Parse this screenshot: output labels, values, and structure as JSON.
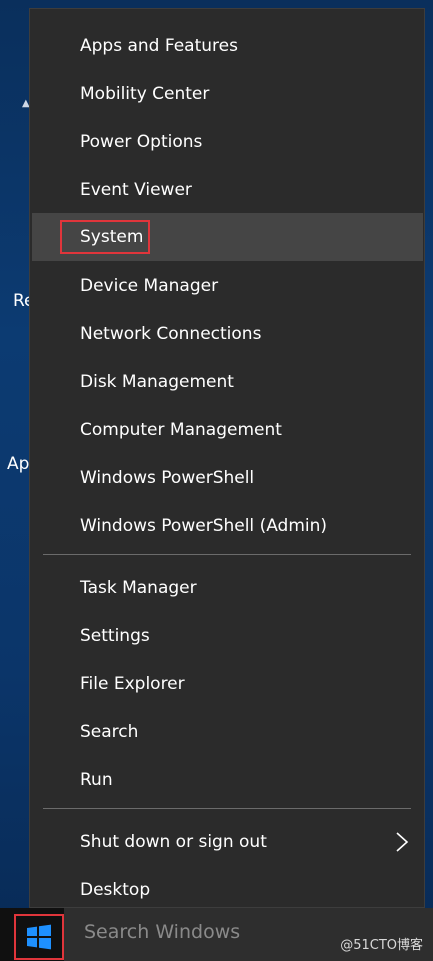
{
  "desktop": {
    "partial_labels": [
      "Re",
      "Ap"
    ]
  },
  "menu": {
    "items": [
      {
        "label": "Apps and Features"
      },
      {
        "label": "Mobility Center"
      },
      {
        "label": "Power Options"
      },
      {
        "label": "Event Viewer"
      },
      {
        "label": "System",
        "state": "hovered"
      },
      {
        "label": "Device Manager"
      },
      {
        "label": "Network Connections"
      },
      {
        "label": "Disk Management"
      },
      {
        "label": "Computer Management"
      },
      {
        "label": "Windows PowerShell"
      },
      {
        "label": "Windows PowerShell (Admin)"
      },
      {
        "label": "Task Manager"
      },
      {
        "label": "Settings"
      },
      {
        "label": "File Explorer"
      },
      {
        "label": "Search"
      },
      {
        "label": "Run"
      },
      {
        "label": "Shut down or sign out",
        "submenu_icon": "chevron-right-icon"
      },
      {
        "label": "Desktop"
      }
    ]
  },
  "taskbar": {
    "start_icon": "windows-logo-icon",
    "search_placeholder": "Search Windows",
    "watermark": "@51CTO博客"
  },
  "colors": {
    "menu_background": "#2b2b2b",
    "hover_background": "#454545",
    "highlight_red": "#e0353b",
    "windows_blue": "#1e90ff"
  }
}
